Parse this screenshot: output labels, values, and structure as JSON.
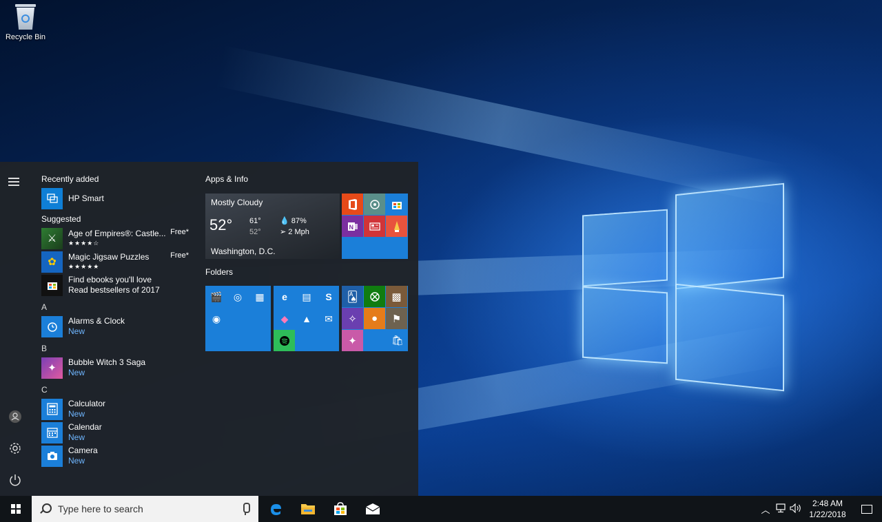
{
  "desktop": {
    "recycle_bin_label": "Recycle Bin"
  },
  "start_menu": {
    "recently_added_header": "Recently added",
    "recent_app": {
      "name": "HP Smart",
      "icon": "hp-smart-icon"
    },
    "suggested_header": "Suggested",
    "suggested": [
      {
        "name": "Age of Empires®: Castle...",
        "price": "Free*",
        "rating": "★★★★☆",
        "icon": "age-of-empires-icon"
      },
      {
        "name": "Magic Jigsaw Puzzles",
        "price": "Free*",
        "rating": "★★★★★",
        "icon": "jigsaw-icon"
      },
      {
        "name": "Find ebooks you'll love",
        "subtitle": "Read bestsellers of 2017",
        "icon": "store-icon"
      }
    ],
    "sections": [
      {
        "letter": "A",
        "apps": [
          {
            "name": "Alarms & Clock",
            "badge": "New"
          }
        ]
      },
      {
        "letter": "B",
        "apps": [
          {
            "name": "Bubble Witch 3 Saga",
            "badge": "New"
          }
        ]
      },
      {
        "letter": "C",
        "apps": [
          {
            "name": "Calculator",
            "badge": "New"
          },
          {
            "name": "Calendar",
            "badge": "New"
          },
          {
            "name": "Camera",
            "badge": "New"
          }
        ]
      }
    ],
    "tiles": {
      "group1_header": "Apps & Info",
      "weather": {
        "condition": "Mostly Cloudy",
        "temperature": "52°",
        "high": "61°",
        "low": "52°",
        "humidity": "87%",
        "wind": "2 Mph",
        "city": "Washington, D.C."
      },
      "group2_header": "Folders"
    }
  },
  "taskbar": {
    "search_placeholder": "Type here to search",
    "time": "2:48 AM",
    "date": "1/22/2018"
  },
  "colors": {
    "accent": "#1b7fd9",
    "menu_bg": "#1f2328",
    "new_badge": "#6fb6ff"
  }
}
